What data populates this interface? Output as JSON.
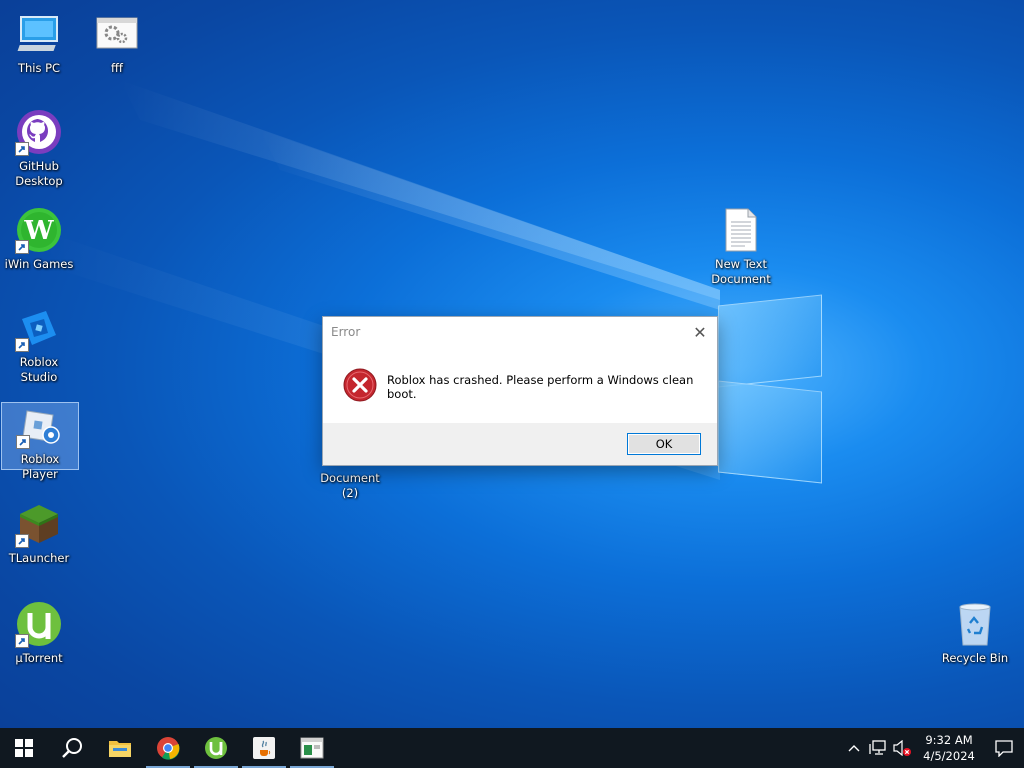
{
  "desktop": {
    "icons": [
      {
        "label": "This PC",
        "icon": "computer-icon"
      },
      {
        "label": "fff",
        "icon": "settings-file-icon"
      },
      {
        "label": "GitHub\nDesktop",
        "icon": "github-icon",
        "shortcut": true
      },
      {
        "label": "iWin Games",
        "icon": "iwin-icon",
        "shortcut": true
      },
      {
        "label": "Roblox Studio",
        "icon": "roblox-studio-icon",
        "shortcut": true
      },
      {
        "label": "Roblox Player",
        "icon": "roblox-player-icon",
        "shortcut": true,
        "selected": true
      },
      {
        "label": "TLauncher",
        "icon": "tlauncher-icon",
        "shortcut": true
      },
      {
        "label": "µTorrent",
        "icon": "utorrent-icon",
        "shortcut": true
      },
      {
        "label": "New Text\nDocument",
        "icon": "text-document-icon"
      },
      {
        "label": "Document (2)",
        "icon": "document-icon"
      },
      {
        "label": "Recycle Bin",
        "icon": "recycle-bin-icon"
      }
    ]
  },
  "dialog": {
    "title": "Error",
    "message": "Roblox has crashed. Please perform a Windows clean boot.",
    "ok_label": "OK",
    "close_glyph": "✕"
  },
  "taskbar": {
    "apps": [
      "start-icon",
      "search-icon",
      "file-explorer-icon",
      "chrome-icon",
      "utorrent-icon",
      "java-icon",
      "app-window-icon"
    ],
    "clock": {
      "time": "9:32 AM",
      "date": "4/5/2024"
    }
  },
  "colors": {
    "accent": "#0078d7",
    "error_red": "#c4262e",
    "taskbar": "#101820"
  }
}
